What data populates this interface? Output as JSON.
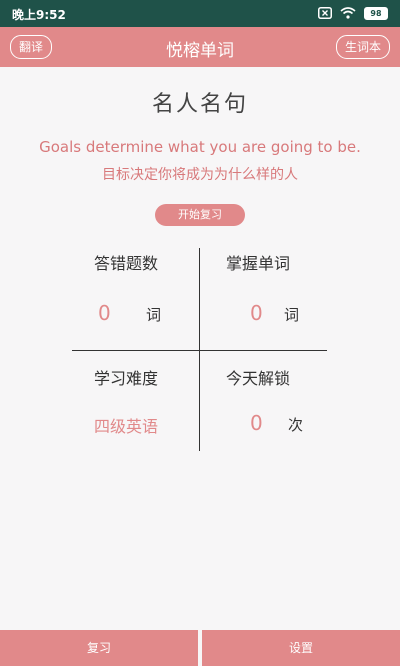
{
  "statusbar": {
    "time": "晚上9:52",
    "battery": "98"
  },
  "appbar": {
    "left_button": "翻译",
    "title": "悦榕单词",
    "right_button": "生词本"
  },
  "main": {
    "heading": "名人名句",
    "quote_en": "Goals determine what you are going to be.",
    "quote_zh": "目标决定你将成为为什么样的人",
    "start_button": "开始复习"
  },
  "stats": {
    "wrong": {
      "label": "答错题数",
      "value": "0",
      "unit": "词"
    },
    "mastered": {
      "label": "掌握单词",
      "value": "0",
      "unit": "词"
    },
    "difficulty": {
      "label": "学习难度",
      "value": "四级英语"
    },
    "unlock": {
      "label": "今天解锁",
      "value": "0",
      "unit": "次"
    }
  },
  "bottom": {
    "review": "复习",
    "settings": "设置"
  },
  "colors": {
    "accent": "#e1898a",
    "statusbar": "#1f5249",
    "background": "#f7f6f7"
  }
}
